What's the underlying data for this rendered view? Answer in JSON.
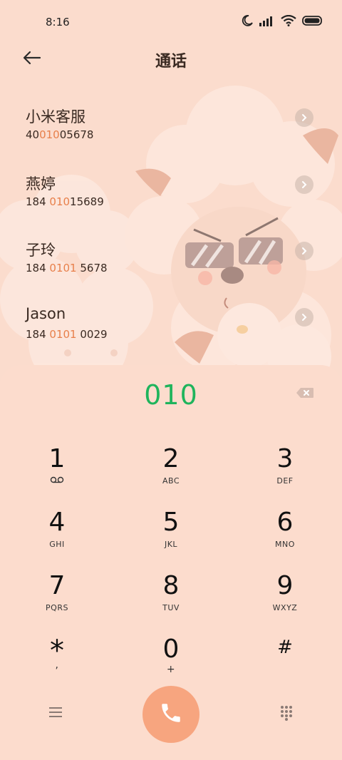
{
  "status_bar": {
    "time": "8:16"
  },
  "header": {
    "title": "通话"
  },
  "contacts": [
    {
      "name": "小米客服",
      "number_parts": [
        "40",
        "010",
        "05678"
      ]
    },
    {
      "name": "燕婷",
      "number_parts": [
        "184 ",
        "010",
        "15689"
      ]
    },
    {
      "name": "子玲",
      "number_parts": [
        "184 ",
        "0101",
        " 5678"
      ]
    },
    {
      "name": "Jason",
      "number_parts": [
        "184 ",
        "0101",
        " 0029"
      ]
    }
  ],
  "dialer": {
    "input": "010",
    "keys": [
      {
        "digit": "1",
        "letters": ""
      },
      {
        "digit": "2",
        "letters": "ABC"
      },
      {
        "digit": "3",
        "letters": "DEF"
      },
      {
        "digit": "4",
        "letters": "GHI"
      },
      {
        "digit": "5",
        "letters": "JKL"
      },
      {
        "digit": "6",
        "letters": "MNO"
      },
      {
        "digit": "7",
        "letters": "PQRS"
      },
      {
        "digit": "8",
        "letters": "TUV"
      },
      {
        "digit": "9",
        "letters": "WXYZ"
      },
      {
        "digit": "*",
        "letters": ","
      },
      {
        "digit": "0",
        "letters": "+"
      },
      {
        "digit": "#",
        "letters": ""
      }
    ]
  },
  "colors": {
    "background": "#fbdccd",
    "highlight": "#e8804b",
    "dialed_text": "#1fb45c",
    "call_button": "#f7a57f"
  },
  "icons": {
    "back": "arrow-left-icon",
    "chevron": "chevron-right-icon",
    "delete": "backspace-icon",
    "voicemail": "voicemail-icon",
    "menu": "menu-icon",
    "call": "phone-icon",
    "keypad": "dialpad-icon"
  }
}
